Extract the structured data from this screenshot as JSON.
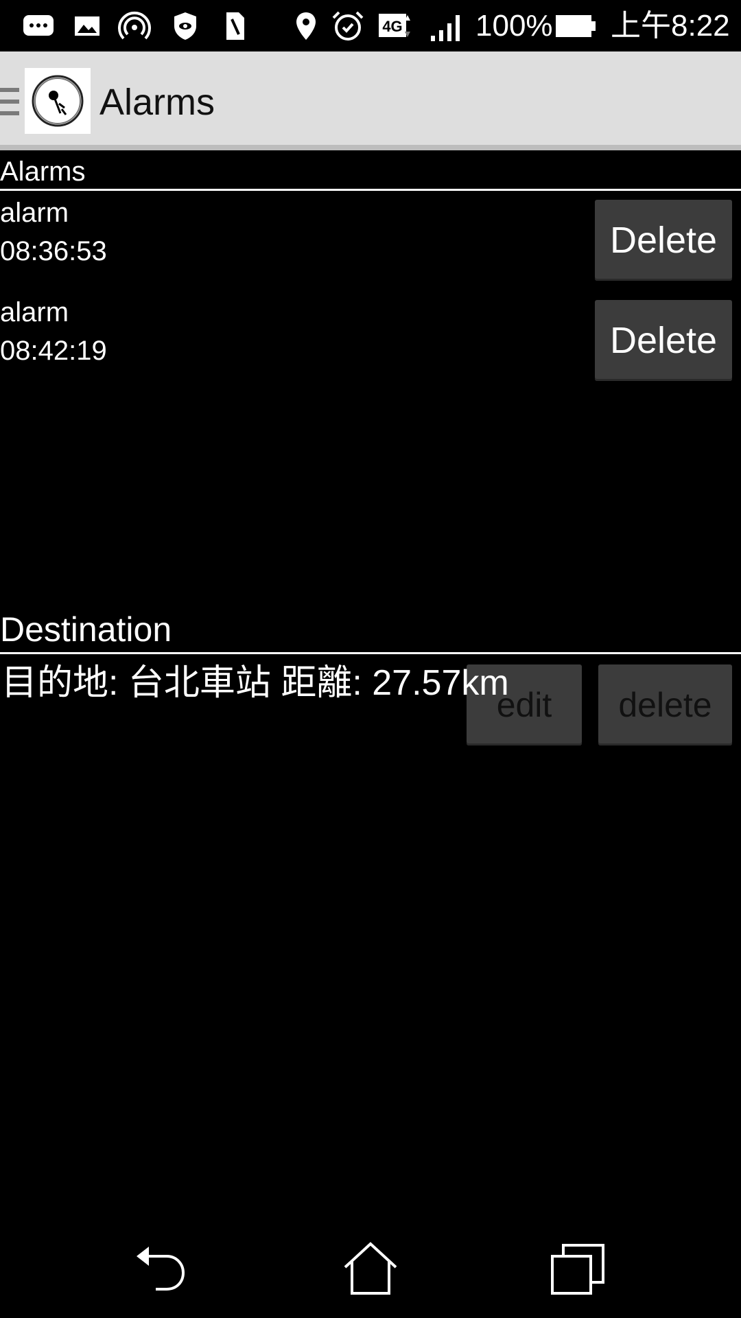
{
  "status_bar": {
    "battery": "100%",
    "network": "4G",
    "time": "上午8:22"
  },
  "action_bar": {
    "title": "Alarms"
  },
  "alarms_section": {
    "header": "Alarms",
    "items": [
      {
        "label": "alarm",
        "time": "08:36:53",
        "delete_label": "Delete"
      },
      {
        "label": "alarm",
        "time": "08:42:19",
        "delete_label": "Delete"
      }
    ]
  },
  "destination_section": {
    "header": "Destination",
    "text": "目的地: 台北車站 距離: 27.57km",
    "edit_label": "edit",
    "delete_label": "delete"
  },
  "icons": {
    "status_left": [
      "chat-bubble-icon",
      "image-icon",
      "hotspot-icon",
      "shield-icon",
      "sim-card-icon"
    ],
    "status_right": [
      "location-pin-icon",
      "alarm-clock-icon",
      "signal-icon",
      "battery-icon"
    ],
    "nav": [
      "back-icon",
      "home-icon",
      "recents-icon"
    ]
  },
  "colors": {
    "background": "#000000",
    "action_bar": "#dedede",
    "button": "#3c3c3c"
  }
}
